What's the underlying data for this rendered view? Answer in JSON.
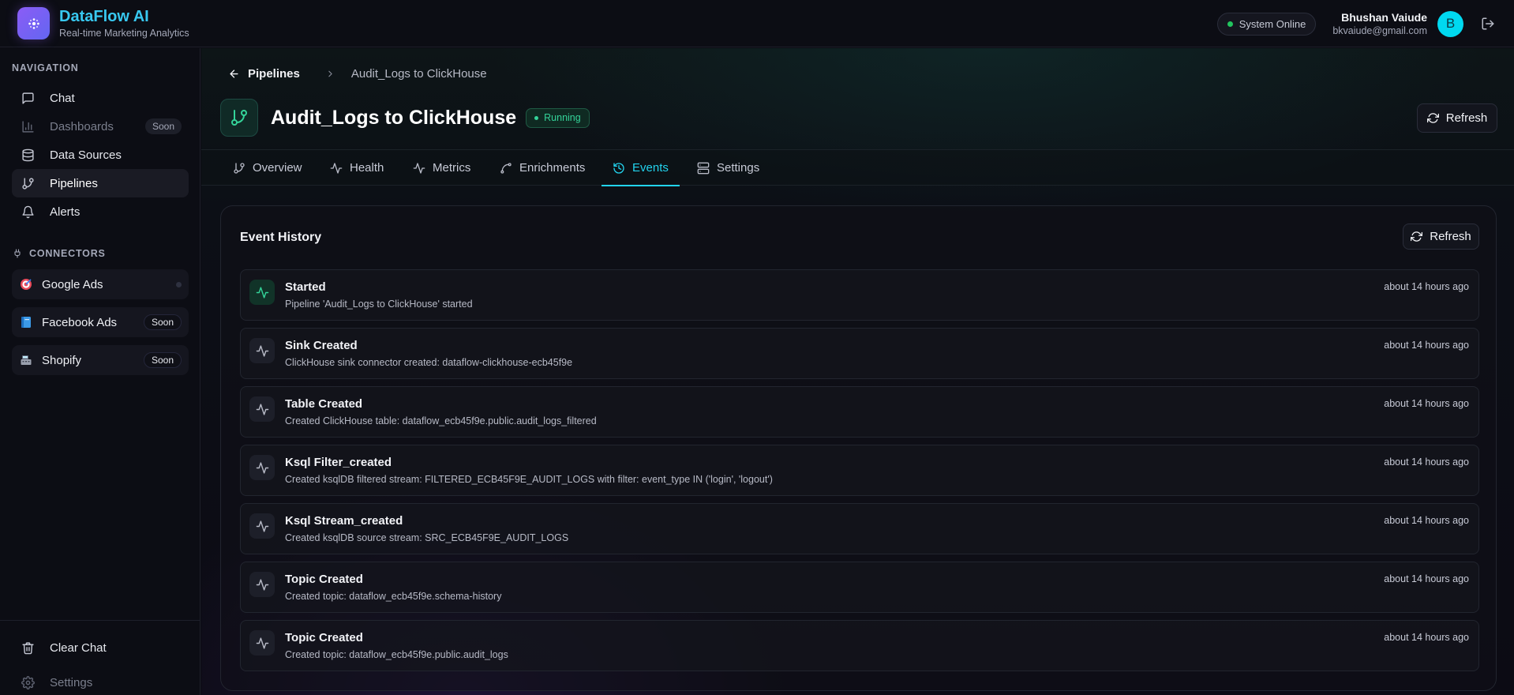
{
  "brand": {
    "name": "DataFlow AI",
    "subtitle": "Real-time Marketing Analytics"
  },
  "header": {
    "system_status": "System Online",
    "user_name": "Bhushan Vaiude",
    "user_email": "bkvaiude@gmail.com",
    "avatar_letter": "B"
  },
  "sidebar": {
    "nav_title": "NAVIGATION",
    "nav_items": [
      {
        "label": "Chat",
        "icon": "message-square-icon"
      },
      {
        "label": "Dashboards",
        "icon": "bar-chart-icon",
        "badge": "Soon"
      },
      {
        "label": "Data Sources",
        "icon": "database-icon"
      },
      {
        "label": "Pipelines",
        "icon": "git-branch-icon"
      },
      {
        "label": "Alerts",
        "icon": "bell-icon"
      }
    ],
    "connectors_title": "CONNECTORS",
    "connectors": [
      {
        "label": "Google Ads",
        "icon": "target-icon"
      },
      {
        "label": "Facebook Ads",
        "icon": "book-icon",
        "badge": "Soon"
      },
      {
        "label": "Shopify",
        "icon": "register-icon",
        "badge": "Soon"
      }
    ],
    "bottom_items": [
      {
        "label": "Clear Chat",
        "icon": "trash-icon"
      },
      {
        "label": "Settings",
        "icon": "gear-icon"
      }
    ]
  },
  "breadcrumb": {
    "back_label": "Pipelines",
    "current": "Audit_Logs to ClickHouse"
  },
  "page": {
    "title": "Audit_Logs to ClickHouse",
    "status": "Running",
    "refresh_label": "Refresh"
  },
  "tabs": [
    {
      "label": "Overview",
      "icon": "git-branch-icon"
    },
    {
      "label": "Health",
      "icon": "activity-icon"
    },
    {
      "label": "Metrics",
      "icon": "activity-icon"
    },
    {
      "label": "Enrichments",
      "icon": "spline-icon"
    },
    {
      "label": "Events",
      "icon": "history-icon",
      "active": true
    },
    {
      "label": "Settings",
      "icon": "server-icon"
    }
  ],
  "events_card": {
    "title": "Event History",
    "refresh_label": "Refresh",
    "events": [
      {
        "title": "Started",
        "description": "Pipeline 'Audit_Logs to ClickHouse' started",
        "time": "about 14 hours ago"
      },
      {
        "title": "Sink Created",
        "description": "ClickHouse sink connector created: dataflow-clickhouse-ecb45f9e",
        "time": "about 14 hours ago"
      },
      {
        "title": "Table Created",
        "description": "Created ClickHouse table: dataflow_ecb45f9e.public.audit_logs_filtered",
        "time": "about 14 hours ago"
      },
      {
        "title": "Ksql Filter_created",
        "description": "Created ksqlDB filtered stream: FILTERED_ECB45F9E_AUDIT_LOGS with filter: event_type IN ('login', 'logout')",
        "time": "about 14 hours ago"
      },
      {
        "title": "Ksql Stream_created",
        "description": "Created ksqlDB source stream: SRC_ECB45F9E_AUDIT_LOGS",
        "time": "about 14 hours ago"
      },
      {
        "title": "Topic Created",
        "description": "Created topic: dataflow_ecb45f9e.schema-history",
        "time": "about 14 hours ago"
      },
      {
        "title": "Topic Created",
        "description": "Created topic: dataflow_ecb45f9e.public.audit_logs",
        "time": "about 14 hours ago"
      }
    ]
  },
  "colors": {
    "accent": "#22d3ee",
    "brand": "#38c8f0",
    "success": "#34d399",
    "logo": "#8b5cf6"
  }
}
